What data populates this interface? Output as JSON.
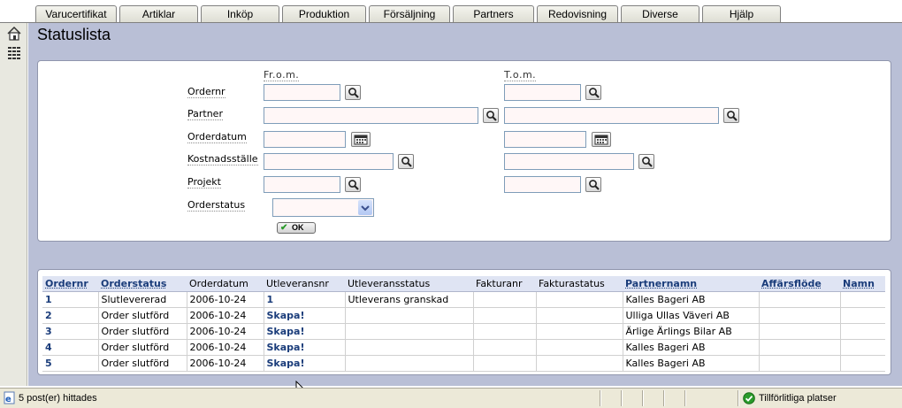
{
  "tabs": [
    "Varucertifikat",
    "Artiklar",
    "Inköp",
    "Produktion",
    "Försäljning",
    "Partners",
    "Redovisning",
    "Diverse",
    "Hjälp"
  ],
  "leftnav": {
    "icons": [
      "home-icon",
      "list-icon"
    ]
  },
  "page": {
    "title": "Statuslista"
  },
  "form": {
    "from_label": "Fr.o.m.",
    "to_label": "T.o.m.",
    "fields": {
      "ordernr": "Ordernr",
      "partner": "Partner",
      "orderdatum": "Orderdatum",
      "kostnadsstalle": "Kostnadsställe",
      "projekt": "Projekt",
      "orderstatus": "Orderstatus"
    },
    "orderstatus_value": "",
    "ok_label": "OK"
  },
  "table": {
    "headers": [
      "Ordernr",
      "Orderstatus",
      "Orderdatum",
      "Utleveransnr",
      "Utleveransstatus",
      "Fakturanr",
      "Fakturastatus",
      "Partnernamn",
      "Affärsflöde",
      "Namn"
    ],
    "rows": [
      [
        "1",
        "Slutlevererad",
        "2006-10-24",
        "1",
        "Utleverans granskad",
        "",
        "",
        "Kalles Bageri AB",
        "",
        ""
      ],
      [
        "2",
        "Order slutförd",
        "2006-10-24",
        "Skapa!",
        "",
        "",
        "",
        "Ulliga Ullas Väveri AB",
        "",
        ""
      ],
      [
        "3",
        "Order slutförd",
        "2006-10-24",
        "Skapa!",
        "",
        "",
        "",
        "Ärlige Ärlings Bilar AB",
        "",
        ""
      ],
      [
        "4",
        "Order slutförd",
        "2006-10-24",
        "Skapa!",
        "",
        "",
        "",
        "Kalles Bageri AB",
        "",
        ""
      ],
      [
        "5",
        "Order slutförd",
        "2006-10-24",
        "Skapa!",
        "",
        "",
        "",
        "Kalles Bageri AB",
        "",
        ""
      ]
    ]
  },
  "statusbar": {
    "left": "5 post(er) hittades",
    "right": "Tillförlitliga platser"
  },
  "colors": {
    "main_bg": "#b9bfd6",
    "link": "#1a3c7a"
  }
}
